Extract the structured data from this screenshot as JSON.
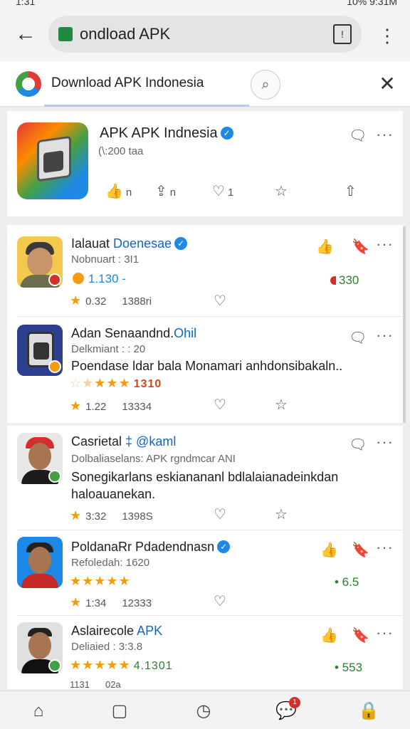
{
  "status": {
    "time": "1:31",
    "right": "10% 9:31M"
  },
  "urlbar": {
    "url": "ondload APK"
  },
  "search": {
    "site_title": "Download APK Indonesia"
  },
  "top_card": {
    "title": "APK APK Indnesia",
    "subtitle": "(\\:200 taa",
    "actions": [
      {
        "icon": "thumb-up-icon",
        "count": "n"
      },
      {
        "icon": "share-icon",
        "count": "n"
      },
      {
        "icon": "heart-icon",
        "count": "1"
      },
      {
        "icon": "star-icon",
        "count": ""
      },
      {
        "icon": "upload-icon",
        "count": ""
      }
    ]
  },
  "items": [
    {
      "title_black": "Ialauat ",
      "title_blue": "Doenesae",
      "verified": true,
      "sub": "Nobnuart : 3I1",
      "value_line": "1.130 -",
      "right_value": "330",
      "meta_a": "0.32",
      "meta_b": "1388ri"
    },
    {
      "title_black": "Adan Senaandnd.",
      "title_blue": "Ohil",
      "sub": "Delkmiant : : 20",
      "desc": "Poendase ldar bala Monamari anhdonsibakaln..",
      "stars_tail": "1310",
      "meta_a": "1.22",
      "meta_b": "13334"
    },
    {
      "title_black": "Casrietal ",
      "title_blue": "‡ @kaml",
      "sub": "Dolbaliaselans: APK rgndmcar ANI",
      "desc": "Sonegikarlans eskianananl bdlalaianadeinkdan haloauanekan.",
      "meta_a": "3:32",
      "meta_b": "1398S"
    },
    {
      "title_black": "PoldanaRr Pdadendnasn",
      "verified": true,
      "sub": "Refoledah: 1620",
      "right_value": "• 6.5",
      "meta_a": "1:34",
      "meta_b": "12333"
    },
    {
      "title_black": "Aslairecole ",
      "title_blue": "APK",
      "sub": "Deliaied : 3:3.8",
      "stars_tail": "4.1301",
      "right_value": "• 553",
      "meta_a": "1131",
      "meta_b": "02a"
    }
  ],
  "icons": {
    "accent_blue": "#1e88e5",
    "star_orange": "#f39c12",
    "positive_green": "#2e7d32",
    "negative_red": "#d32f2f"
  },
  "navbar": {
    "notification_count": "1"
  }
}
